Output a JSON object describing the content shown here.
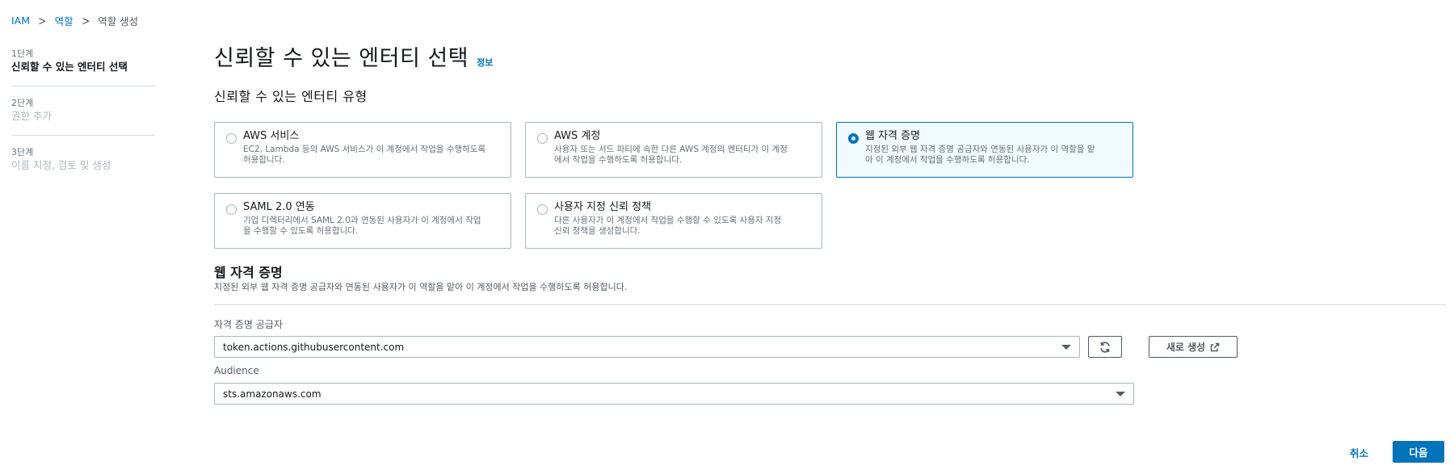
{
  "breadcrumb": {
    "items": [
      "IAM",
      "역할",
      "역할 생성"
    ]
  },
  "steps": [
    {
      "num": "1단계",
      "label": "신뢰할 수 있는 엔터티 선택"
    },
    {
      "num": "2단계",
      "label": "권한 추가"
    },
    {
      "num": "3단계",
      "label": "이름 지정, 검토 및 생성"
    }
  ],
  "page": {
    "title": "신뢰할 수 있는 엔터티 선택",
    "info": "정보",
    "section_heading": "신뢰할 수 있는 엔터티 유형"
  },
  "entity_types": [
    {
      "title": "AWS 서비스",
      "desc_line1": "EC2, Lambda 등의 AWS 서비스가 이 계정에서 작업을 수행하도록",
      "desc_line2": "허용합니다.",
      "selected": false
    },
    {
      "title": "AWS 계정",
      "desc_line1": "사용자 또는 서드 파티에 속한 다른 AWS 계정의 엔터티가 이 계정",
      "desc_line2": "에서 작업을 수행하도록 허용합니다.",
      "selected": false
    },
    {
      "title": "웹 자격 증명",
      "desc_line1": "지정된 외부 웹 자격 증명 공급자와 연동된 사용자가 이 역할을 맡",
      "desc_line2": "아 이 계정에서 작업을 수행하도록 허용합니다.",
      "selected": true
    },
    {
      "title": "SAML 2.0 연동",
      "desc_line1": "기업 디렉터리에서 SAML 2.0과 연동된 사용자가 이 계정에서 작업",
      "desc_line2": "을 수행할 수 있도록 허용합니다.",
      "selected": false
    },
    {
      "title": "사용자 지정 신뢰 정책",
      "desc_line1": "다른 사용자가 이 계정에서 작업을 수행할 수 있도록 사용자 지정",
      "desc_line2": "신뢰 정책을 생성합니다.",
      "selected": false
    }
  ],
  "web_identity": {
    "heading": "웹 자격 증명",
    "description": "지정된 외부 웹 자격 증명 공급자와 연동된 사용자가 이 역할을 맡아 이 계정에서 작업을 수행하도록 허용합니다.",
    "provider_label": "자격 증명 공급자",
    "provider_value": "token.actions.githubusercontent.com",
    "audience_label": "Audience",
    "audience_value": "sts.amazonaws.com",
    "create_new_label": "새로 생성"
  },
  "footer": {
    "cancel_label": "취소",
    "next_label": "다음"
  },
  "colors": {
    "accent": "#0073bb",
    "selected_bg": "#f1faff",
    "border": "#aab7b8"
  },
  "icons": {
    "refresh": "refresh-icon",
    "external": "external-link-icon",
    "separator": "chevron-right-icon"
  }
}
